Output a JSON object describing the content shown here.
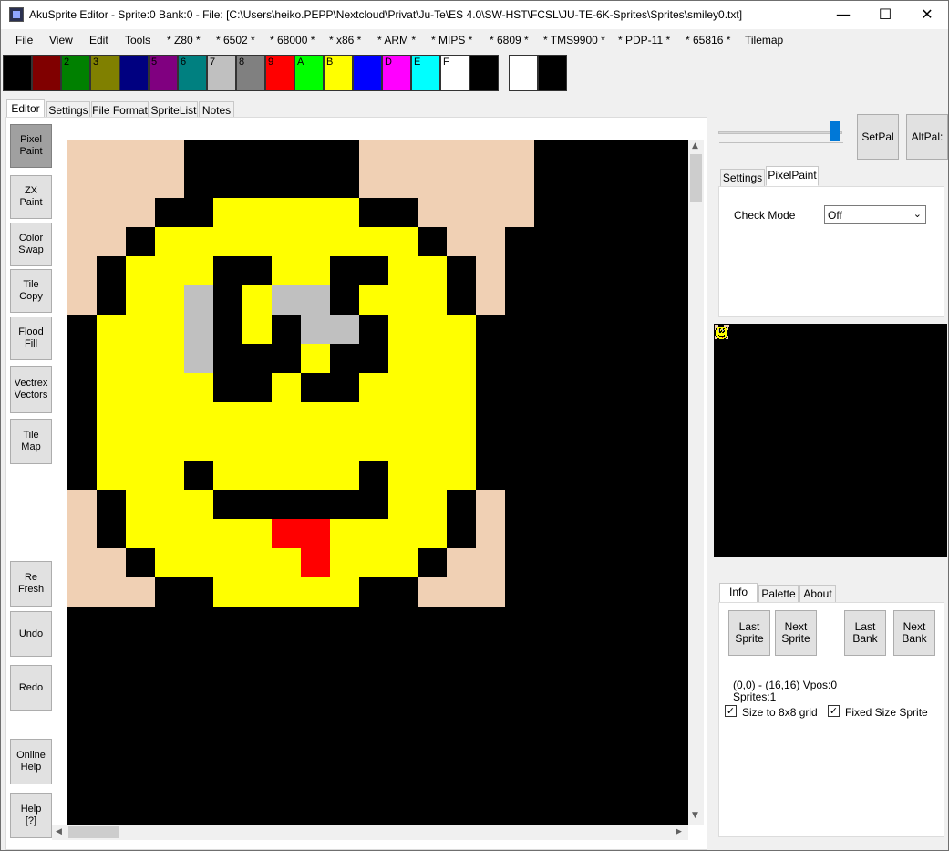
{
  "window": {
    "title": "AkuSprite Editor -  Sprite:0  Bank:0 - File: [C:\\Users\\heiko.PEPP\\Nextcloud\\Privat\\Ju-Te\\ES 4.0\\SW-HST\\FCSL\\JU-TE-6K-Sprites\\Sprites\\smiley0.txt]",
    "minimize": "—",
    "maximize": "☐",
    "close": "✕"
  },
  "menu": [
    "File",
    "View",
    "Edit",
    "Tools",
    "* Z80 *",
    "* 6502 *",
    "* 68000 *",
    "* x86 *",
    "* ARM *",
    "* MIPS *",
    "* 6809 *",
    "* TMS9900 *",
    "* PDP-11 *",
    "* 65816 *",
    "Tilemap"
  ],
  "palette": [
    {
      "label": "",
      "color": "#000000"
    },
    {
      "label": "",
      "color": "#800000"
    },
    {
      "label": "2",
      "color": "#008000"
    },
    {
      "label": "3",
      "color": "#808000"
    },
    {
      "label": "",
      "color": "#000080"
    },
    {
      "label": "5",
      "color": "#800080"
    },
    {
      "label": "6",
      "color": "#008080"
    },
    {
      "label": "7",
      "color": "#c0c0c0"
    },
    {
      "label": "8",
      "color": "#808080"
    },
    {
      "label": "9",
      "color": "#ff0000"
    },
    {
      "label": "A",
      "color": "#00ff00"
    },
    {
      "label": "B",
      "color": "#ffff00"
    },
    {
      "label": "",
      "color": "#0000ff"
    },
    {
      "label": "D",
      "color": "#ff00ff"
    },
    {
      "label": "E",
      "color": "#00ffff"
    },
    {
      "label": "F",
      "color": "#ffffff"
    },
    {
      "label": "",
      "color": "#000000"
    }
  ],
  "selected_colors": {
    "primary": "#ffffff",
    "secondary": "#000000"
  },
  "editor_tabs": [
    "Editor",
    "Settings",
    "File Format",
    "SpriteList",
    "Notes"
  ],
  "tools": [
    {
      "label": "Pixel\nPaint",
      "name": "tool-pixel-paint"
    },
    {
      "label": "ZX\nPaint",
      "name": "tool-zx-paint"
    },
    {
      "label": "Color\nSwap",
      "name": "tool-color-swap"
    },
    {
      "label": "Tile\nCopy",
      "name": "tool-tile-copy"
    },
    {
      "label": "Flood\nFill",
      "name": "tool-flood-fill"
    },
    {
      "label": "Vectrex\nVectors",
      "name": "tool-vectrex-vectors"
    },
    {
      "label": "Tile\nMap",
      "name": "tool-tile-map"
    },
    {
      "label": "Re\nFresh",
      "name": "refresh-button"
    },
    {
      "label": "Undo",
      "name": "undo-button"
    },
    {
      "label": "Redo",
      "name": "redo-button"
    },
    {
      "label": "Online\nHelp",
      "name": "online-help-button"
    },
    {
      "label": "Help\n[?]",
      "name": "help-button"
    }
  ],
  "sprite": {
    "palette_map": {
      "s": "#f0d0b4",
      "k": "#000000",
      "y": "#ffff00",
      "r": "#ff0000",
      "g": "#c0c0c0"
    },
    "rows": [
      "sssskkkkkkssssss",
      "sssskkkkkkssssss",
      "ssskkyyyyykkssss",
      "sskyyyyyyyyykss",
      "skyyykkyykkyyks",
      "skyygkyggkyyyks",
      "kyyygkykggkyyyk",
      "kyyygkkkykkyyyk",
      "kyyyykkykkyyyyk",
      "kyyyyyyyyyyyyyk",
      "kyyyyyyyyyyyyyk",
      "kyyykyyyyykyyyk",
      "skyyykkkkkkyyks",
      "skyyyyyrryyyyks",
      "sskyyyyyryyykss",
      "ssskkyyyyykksss"
    ]
  },
  "right": {
    "set_pal": "SetPal",
    "alt_pal": "AltPal:",
    "tabs": [
      "Settings",
      "PixelPaint"
    ],
    "check_mode_label": "Check Mode",
    "check_mode_value": "Off",
    "slider_level": 0.98,
    "info_tabs": [
      "Info",
      "Palette",
      "About"
    ],
    "last_sprite": "Last\nSprite",
    "next_sprite": "Next\nSprite",
    "last_bank": "Last\nBank",
    "next_bank": "Next\nBank",
    "coords": "(0,0) - (16,16)   Vpos:0",
    "sprites_count": "Sprites:1",
    "size_to_grid": "Size to 8x8 grid",
    "fixed_size": "Fixed Size Sprite",
    "size_to_grid_checked": "✓",
    "fixed_size_checked": "✓"
  }
}
